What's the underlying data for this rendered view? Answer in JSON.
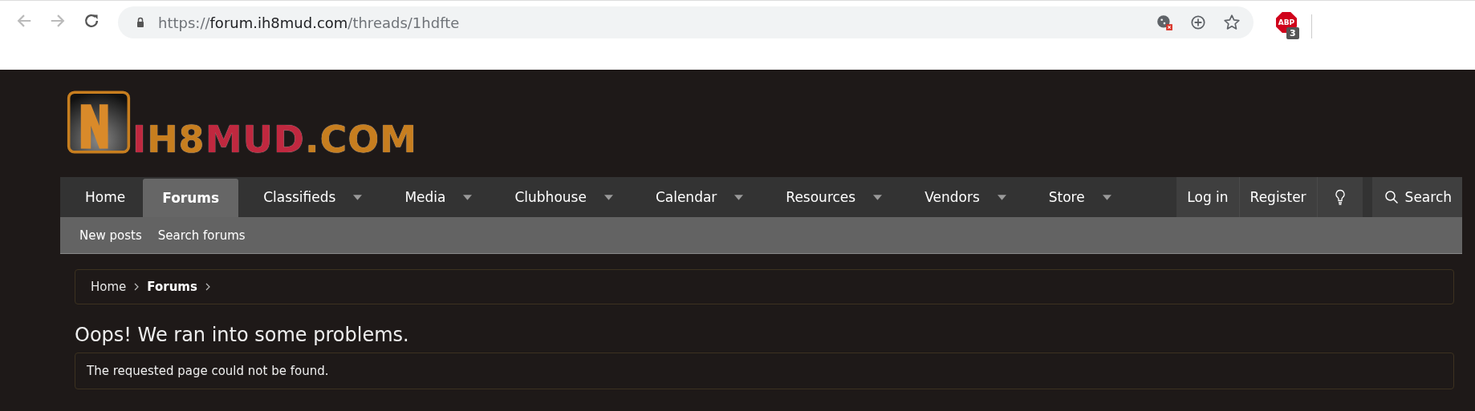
{
  "browser": {
    "url_scheme": "https://",
    "url_host": "forum.ih8mud.com",
    "url_path": "/threads/1hdfte",
    "extension_label": "ABP",
    "extension_badge": "3"
  },
  "logo": {
    "parts": [
      {
        "text": "I",
        "color": "#c0283f"
      },
      {
        "text": "H8",
        "color": "#c77e1f"
      },
      {
        "text": "MUD",
        "color": "#c0283f"
      },
      {
        "text": ".COM",
        "color": "#c77e1f"
      }
    ]
  },
  "nav": {
    "tabs": [
      {
        "label": "Home",
        "selected": false,
        "dropdown": false
      },
      {
        "label": "Forums",
        "selected": true,
        "dropdown": false
      },
      {
        "label": "Classifieds",
        "selected": false,
        "dropdown": true
      },
      {
        "label": "Media",
        "selected": false,
        "dropdown": true
      },
      {
        "label": "Clubhouse",
        "selected": false,
        "dropdown": true
      },
      {
        "label": "Calendar",
        "selected": false,
        "dropdown": true
      },
      {
        "label": "Resources",
        "selected": false,
        "dropdown": true
      },
      {
        "label": "Vendors",
        "selected": false,
        "dropdown": true
      },
      {
        "label": "Store",
        "selected": false,
        "dropdown": true
      }
    ],
    "account": [
      "Log in",
      "Register"
    ],
    "search": "Search"
  },
  "subnav": [
    "New posts",
    "Search forums"
  ],
  "breadcrumb": [
    {
      "label": "Home",
      "current": false
    },
    {
      "label": "Forums",
      "current": true
    }
  ],
  "heading": "Oops! We ran into some problems.",
  "message": "The requested page could not be found."
}
